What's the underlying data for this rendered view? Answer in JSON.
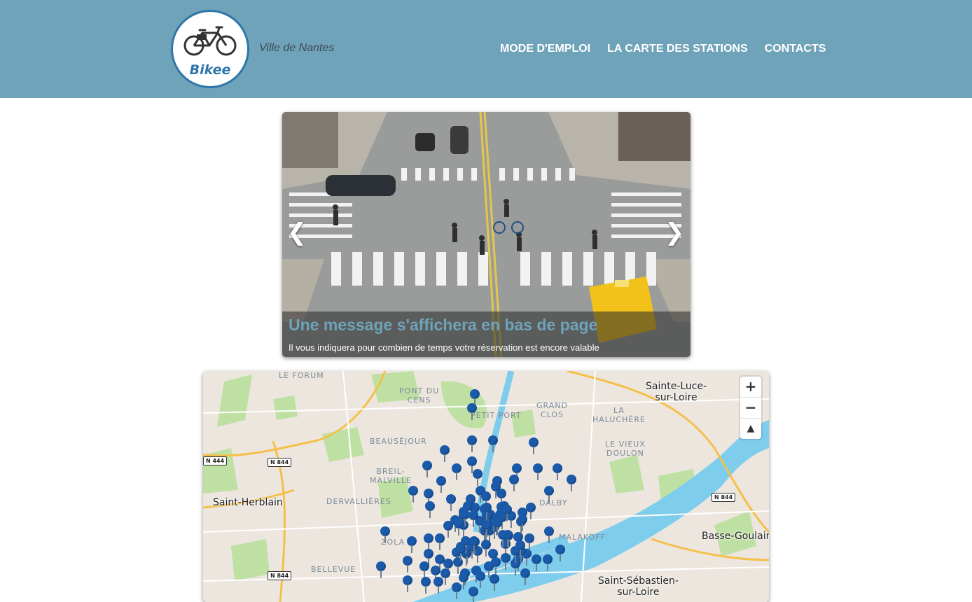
{
  "header": {
    "logo_text": "Bikee",
    "tagline": "Ville de Nantes",
    "nav": [
      {
        "label": "MODE D'EMPLOI"
      },
      {
        "label": "LA CARTE DES STATIONS"
      },
      {
        "label": "CONTACTS"
      }
    ]
  },
  "carousel": {
    "caption_title": "Une message s'affichera en bas de page",
    "caption_text": "Il vous indiquera pour combien de temps votre réservation est encore valable",
    "prev_icon": "chevron-left-icon",
    "next_icon": "chevron-right-icon"
  },
  "map": {
    "places": {
      "le_forum": "LE FORUM",
      "pont_du_cens": "PONT DU\nCENS",
      "petit_port": "PETIT PORT",
      "grand_clos": "GRAND\nCLOS",
      "la_haluchere": "LA\nHALUCHÈRE",
      "beausejour": "BEAUSÉJOUR",
      "le_vieux_doulon": "LE VIEUX\nDOULON",
      "breil_malville": "BREIL-\nMALVILLE",
      "dervallieres": "DERVALLIÈRES",
      "dalby": "DALBY",
      "zola": "ZOLA",
      "malakoff": "MALAKOFF",
      "bellevue": "BELLEVUE"
    },
    "cities": {
      "sainte_luce": "Sainte-Luce-\nsur-Loire",
      "saint_herblain": "Saint-Herblain",
      "basse_goulaine": "Basse-Goulain",
      "saint_sebastien": "Saint-Sébastien-\nsur-Loire"
    },
    "roads": {
      "n444": "N 444",
      "n844_a": "N 844",
      "n844_b": "N 844",
      "n844_c": "N 844"
    },
    "controls": {
      "zoom_in": "+",
      "zoom_out": "−",
      "compass": "▲"
    },
    "colors": {
      "water": "#7fcdec",
      "park": "#bfe0a3",
      "land": "#ece6df",
      "motorway": "#f5c04a",
      "marker": "#1a5aa8"
    },
    "station_count": 120
  }
}
